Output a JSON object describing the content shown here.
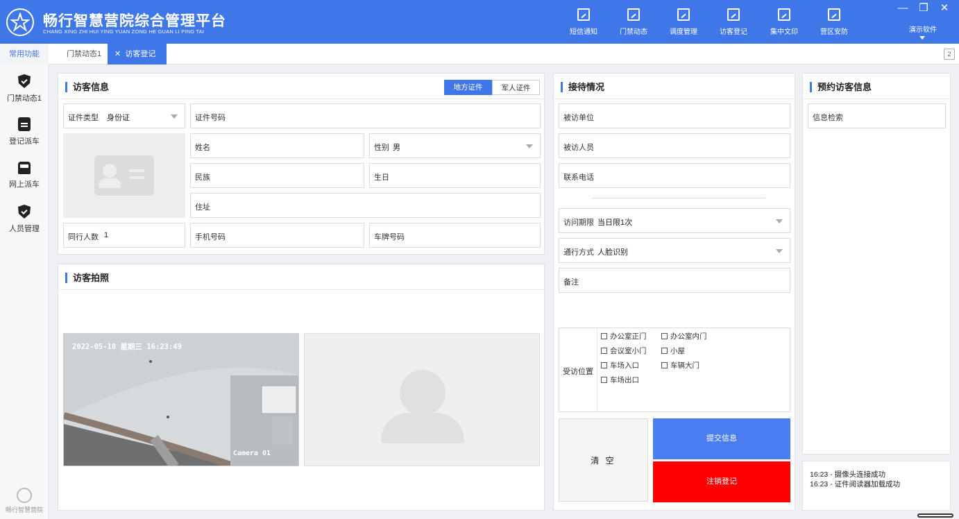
{
  "header": {
    "title": "畅行智慧营院综合管理平台",
    "subtitle": "CHANG XING ZHI HUI YING YUAN ZONG HE GUAN LI PING TAI",
    "nav": [
      {
        "label": "短信通知",
        "icon": "doc-edit-icon"
      },
      {
        "label": "门禁动态",
        "icon": "doc-edit-icon"
      },
      {
        "label": "调度管理",
        "icon": "id-badge-icon"
      },
      {
        "label": "访客登记",
        "icon": "doc-edit-icon"
      },
      {
        "label": "集中文印",
        "icon": "doc-edit-icon"
      },
      {
        "label": "营区安防",
        "icon": "doc-edit-icon"
      }
    ],
    "user_menu": "演示软件",
    "window_controls": {
      "minimize": "—",
      "restore": "❐",
      "close": "✕"
    }
  },
  "tabbar": {
    "common": "常用功能",
    "tabs": [
      "门禁动态1",
      "访客登记"
    ],
    "close_glyph": "✕",
    "count": "2"
  },
  "sidebar": {
    "items": [
      "门禁动态1",
      "登记派车",
      "网上派车",
      "人员管理"
    ],
    "footer": "畅行智慧营院"
  },
  "visitor_info": {
    "title": "访客信息",
    "toggle": [
      "地方证件",
      "军人证件"
    ],
    "id_type_label": "证件类型",
    "id_type_value": "身份证",
    "id_number_label": "证件号码",
    "name_label": "姓名",
    "gender_label": "性别",
    "gender_value": "男",
    "ethnicity_label": "民族",
    "birthday_label": "生日",
    "address_label": "住址",
    "companions_label": "同行人数",
    "companions_value": "1",
    "phone_label": "手机号码",
    "plate_label": "车牌号码"
  },
  "photo": {
    "title": "访客拍照",
    "timestamp": "2022-05-18 星期三 16:23:49",
    "camera_name": "Camera 01"
  },
  "reception": {
    "title": "接待情况",
    "unit_label": "被访单位",
    "person_label": "被访人员",
    "phone_label": "联系电话",
    "period_label": "访问期限",
    "period_value": "当日限1次",
    "access_label": "通行方式",
    "access_value": "人脸识别",
    "remark_label": "备注",
    "location_label": "受访位置",
    "locations": [
      "办公室正门",
      "办公室内门",
      "会议室小门",
      "小屋",
      "车场入口",
      "车辆大门",
      "车场出口"
    ],
    "clear_btn": "清 空",
    "submit_btn": "提交信息",
    "cancel_btn": "注销登记"
  },
  "appointment": {
    "title": "预约访客信息",
    "search_label": "信息检索"
  },
  "log": [
    "16:23 - 摄像头连接成功",
    "16:23 - 证件阅读器加载成功"
  ],
  "colors": {
    "primary": "#3f76e8",
    "danger": "#ff0000",
    "background": "#eef0f3"
  }
}
